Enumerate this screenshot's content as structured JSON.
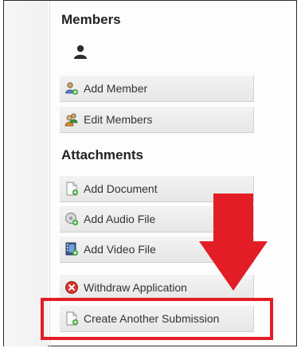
{
  "members": {
    "heading": "Members",
    "buttons": [
      {
        "label": "Add Member",
        "icon": "add-member-icon"
      },
      {
        "label": "Edit Members",
        "icon": "edit-members-icon"
      }
    ]
  },
  "attachments": {
    "heading": "Attachments",
    "buttons": [
      {
        "label": "Add Document",
        "icon": "add-document-icon"
      },
      {
        "label": "Add Audio File",
        "icon": "add-audio-icon"
      },
      {
        "label": "Add Video File",
        "icon": "add-video-icon"
      }
    ]
  },
  "actions": {
    "withdraw_label": "Withdraw Application",
    "create_label": "Create Another Submission"
  },
  "colors": {
    "highlight": "#e31d25",
    "arrow": "#e31d25",
    "button_bg": "#eeeeee"
  }
}
